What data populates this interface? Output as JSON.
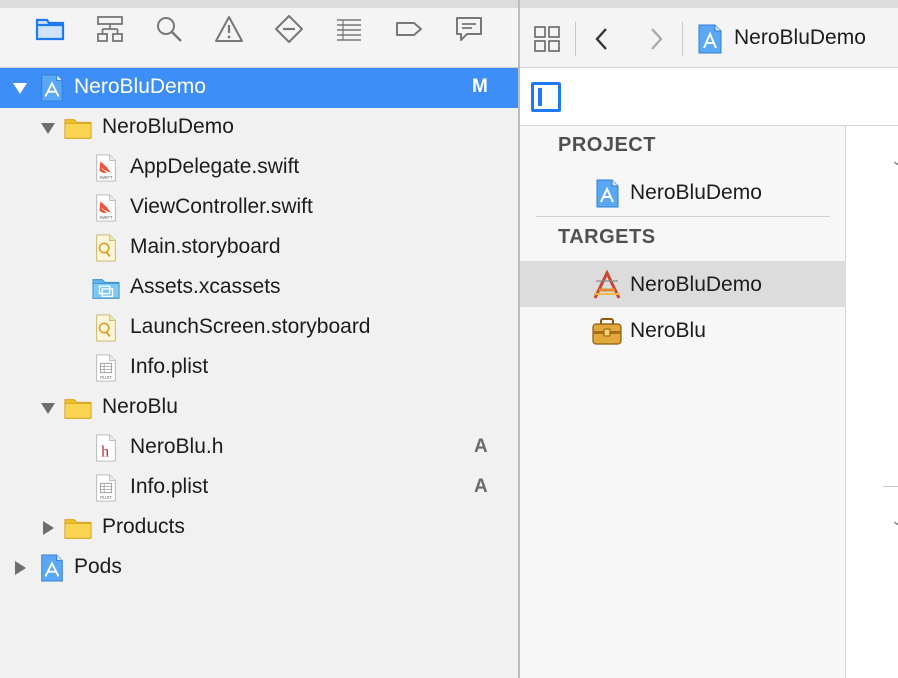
{
  "navigator": {
    "tabs": [
      {
        "name": "project-navigator-tab",
        "icon": "folder-icon",
        "active": true
      },
      {
        "name": "symbol-navigator-tab",
        "icon": "hierarchy-icon"
      },
      {
        "name": "find-navigator-tab",
        "icon": "search-icon"
      },
      {
        "name": "issue-navigator-tab",
        "icon": "warning-icon"
      },
      {
        "name": "test-navigator-tab",
        "icon": "diamond-minus-icon"
      },
      {
        "name": "debug-navigator-tab",
        "icon": "list-icon"
      },
      {
        "name": "breakpoint-navigator-tab",
        "icon": "tag-icon"
      },
      {
        "name": "report-navigator-tab",
        "icon": "speech-bubble-icon"
      }
    ],
    "tree": [
      {
        "label": "NeroBluDemo",
        "badge": "M",
        "indent": 0,
        "icon": "xcode-project-icon",
        "expanded": true,
        "selected": true
      },
      {
        "label": "NeroBluDemo",
        "badge": "",
        "indent": 1,
        "icon": "folder-icon",
        "expanded": true
      },
      {
        "label": "AppDelegate.swift",
        "badge": "",
        "indent": 2,
        "icon": "swift-file-icon"
      },
      {
        "label": "ViewController.swift",
        "badge": "",
        "indent": 2,
        "icon": "swift-file-icon"
      },
      {
        "label": "Main.storyboard",
        "badge": "",
        "indent": 2,
        "icon": "storyboard-icon"
      },
      {
        "label": "Assets.xcassets",
        "badge": "",
        "indent": 2,
        "icon": "asset-catalog-icon"
      },
      {
        "label": "LaunchScreen.storyboard",
        "badge": "",
        "indent": 2,
        "icon": "storyboard-icon"
      },
      {
        "label": "Info.plist",
        "badge": "",
        "indent": 2,
        "icon": "plist-file-icon"
      },
      {
        "label": "NeroBlu",
        "badge": "",
        "indent": 1,
        "icon": "folder-icon",
        "expanded": true
      },
      {
        "label": "NeroBlu.h",
        "badge": "A",
        "indent": 2,
        "icon": "header-file-icon"
      },
      {
        "label": "Info.plist",
        "badge": "A",
        "indent": 2,
        "icon": "plist-file-icon"
      },
      {
        "label": "Products",
        "badge": "",
        "indent": 1,
        "icon": "folder-icon",
        "expanded": false
      },
      {
        "label": "Pods",
        "badge": "",
        "indent": 0,
        "icon": "xcode-project-icon",
        "expanded": false
      }
    ]
  },
  "editor": {
    "jump_bar": {
      "title": "NeroBluDemo",
      "title_icon": "xcode-project-icon"
    },
    "outline": {
      "project_header": "PROJECT",
      "project_item": "NeroBluDemo",
      "targets_header": "TARGETS",
      "targets": [
        {
          "label": "NeroBluDemo",
          "icon": "app-target-icon",
          "selected": true
        },
        {
          "label": "NeroBlu",
          "icon": "framework-toolbox-icon",
          "selected": false
        }
      ]
    }
  },
  "colors": {
    "selection": "#3d8ef7",
    "accent": "#1e79f3",
    "folder": "#f7c93e",
    "navigator_bg": "#f1f1f2"
  }
}
